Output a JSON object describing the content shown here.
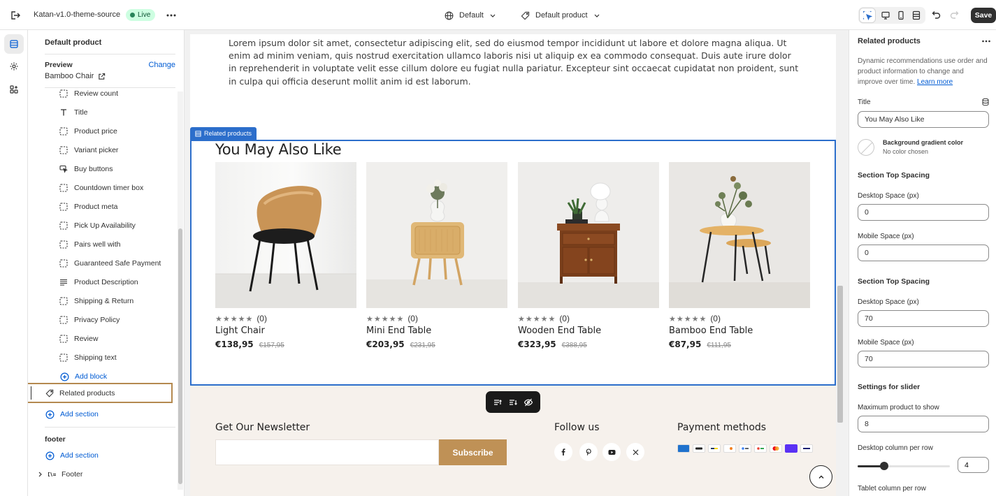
{
  "topbar": {
    "theme_name": "Katan-v1.0-theme-source",
    "status_badge": "Live",
    "market_select": "Default",
    "template_select": "Default product",
    "save_label": "Save"
  },
  "sidebar": {
    "template_title": "Default product",
    "preview_label": "Preview",
    "change_label": "Change",
    "preview_product": "Bamboo Chair",
    "blocks": [
      {
        "label": "Review count",
        "icon": "dashed-square-icon"
      },
      {
        "label": "Title",
        "icon": "text-title-icon"
      },
      {
        "label": "Product price",
        "icon": "dashed-square-icon"
      },
      {
        "label": "Variant picker",
        "icon": "dashed-square-icon"
      },
      {
        "label": "Buy buttons",
        "icon": "cursor-click-icon"
      },
      {
        "label": "Countdown timer box",
        "icon": "dashed-square-icon"
      },
      {
        "label": "Product meta",
        "icon": "dashed-square-icon"
      },
      {
        "label": "Pick Up Availability",
        "icon": "dashed-square-icon"
      },
      {
        "label": "Pairs well with",
        "icon": "dashed-square-icon"
      },
      {
        "label": "Guaranteed Safe Payment",
        "icon": "dashed-square-icon"
      },
      {
        "label": "Product Description",
        "icon": "text-lines-icon"
      },
      {
        "label": "Shipping & Return",
        "icon": "dashed-square-icon"
      },
      {
        "label": "Privacy Policy",
        "icon": "dashed-square-icon"
      },
      {
        "label": "Review",
        "icon": "dashed-square-icon"
      },
      {
        "label": "Shipping text",
        "icon": "dashed-square-icon"
      }
    ],
    "add_block_label": "Add block",
    "selected_section": "Related products",
    "add_section_label": "Add section",
    "footer_group_label": "footer",
    "footer_add_section_label": "Add section",
    "footer_section": "Footer"
  },
  "preview": {
    "lorem": "Lorem ipsum dolor sit amet, consectetur adipiscing elit, sed do eiusmod tempor incididunt ut labore et dolore magna aliqua. Ut enim ad minim veniam, quis nostrud exercitation ullamco laboris nisi ut aliquip ex ea commodo consequat. Duis aute irure dolor in reprehenderit in voluptate velit esse cillum dolore eu fugiat nulla pariatur. Excepteur sint occaecat cupidatat non proident, sunt in culpa qui officia deserunt mollit anim id est laborum.",
    "section_tag": "Related products",
    "section_title": "You May Also Like",
    "products": [
      {
        "name": "Light Chair",
        "stars": "★★★★★",
        "reviews": "(0)",
        "price": "€138,95",
        "compare": "€157,95"
      },
      {
        "name": "Mini End Table",
        "stars": "★★★★★",
        "reviews": "(0)",
        "price": "€203,95",
        "compare": "€231,95"
      },
      {
        "name": "Wooden End Table",
        "stars": "★★★★★",
        "reviews": "(0)",
        "price": "€323,95",
        "compare": "€388,95"
      },
      {
        "name": "Bamboo End Table",
        "stars": "★★★★★",
        "reviews": "(0)",
        "price": "€87,95",
        "compare": "€111,95"
      }
    ],
    "newsletter_title": "Get Our Newsletter",
    "newsletter_placeholder": "",
    "subscribe_label": "Subscribe",
    "follow_title": "Follow us",
    "payment_title": "Payment methods",
    "colors": {
      "accent": "#bf9156",
      "selection": "#2c6ecb",
      "footer_bg": "#f6f1ec"
    }
  },
  "settings": {
    "title": "Related products",
    "description": "Dynamic recommendations use order and product information to change and improve over time.",
    "learn_more": "Learn more",
    "title_label": "Title",
    "title_value": "You May Also Like",
    "gradient_label": "Background gradient color",
    "gradient_value": "No color chosen",
    "spacing_group_1": "Section Top Spacing",
    "desktop_space_label_1": "Desktop Space (px)",
    "desktop_space_value_1": "0",
    "mobile_space_label_1": "Mobile Space (px)",
    "mobile_space_value_1": "0",
    "spacing_group_2": "Section Top Spacing",
    "desktop_space_label_2": "Desktop Space (px)",
    "desktop_space_value_2": "70",
    "mobile_space_label_2": "Mobile Space (px)",
    "mobile_space_value_2": "70",
    "slider_group": "Settings for slider",
    "max_product_label": "Maximum product to show",
    "max_product_value": "8",
    "desktop_columns_label": "Desktop column per row",
    "desktop_columns_value": "4",
    "desktop_columns_fraction": 0.29,
    "tablet_columns_label": "Tablet column per row"
  }
}
